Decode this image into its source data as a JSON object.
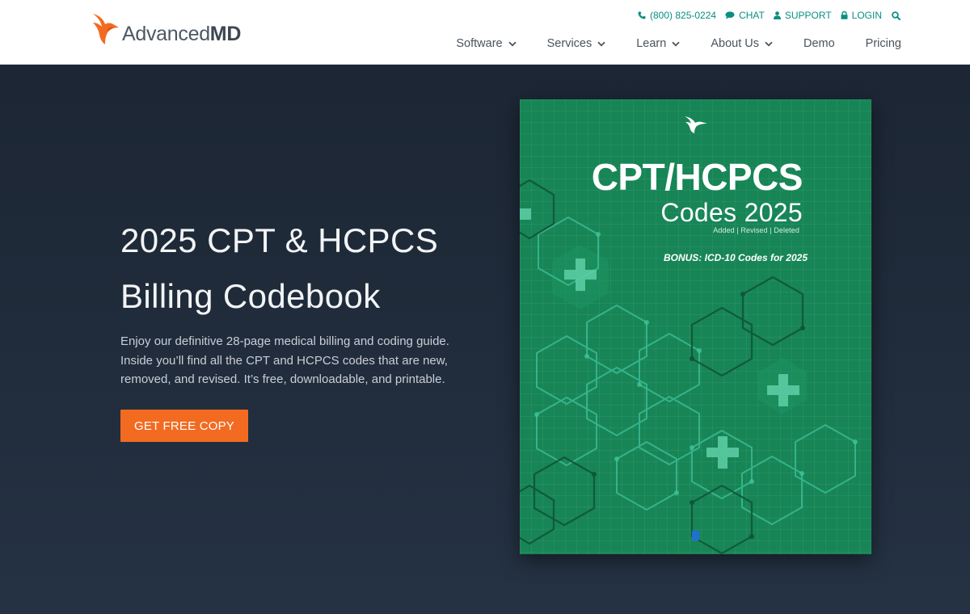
{
  "brand": {
    "logo_regular": "Advanced",
    "logo_bold": "MD"
  },
  "utility_nav": [
    {
      "icon": "phone-icon",
      "label": "(800) 825-0224"
    },
    {
      "icon": "chat-icon",
      "label": "CHAT"
    },
    {
      "icon": "user-icon",
      "label": "SUPPORT"
    },
    {
      "icon": "lock-icon",
      "label": "LOGIN"
    }
  ],
  "main_nav": [
    {
      "label": "Software",
      "dropdown": true
    },
    {
      "label": "Services",
      "dropdown": true
    },
    {
      "label": "Learn",
      "dropdown": true
    },
    {
      "label": "About Us",
      "dropdown": true
    },
    {
      "label": "Demo",
      "dropdown": false
    },
    {
      "label": "Pricing",
      "dropdown": false
    }
  ],
  "hero": {
    "title_line1": "2025 CPT & HCPCS",
    "title_line2": "Billing Codebook",
    "description": "Enjoy our definitive 28-page medical billing and coding guide. Inside you’ll find all the CPT and HCPCS codes that are new, removed, and revised. It’s free, downloadable, and printable.",
    "cta_label": "GET FREE COPY"
  },
  "book": {
    "title": "CPT/HCPCS",
    "subtitle": "Codes 2025",
    "tags": "Added | Revised | Deleted",
    "bonus": "BONUS: ICD-10 Codes for 2025"
  },
  "colors": {
    "accent_orange": "#f26b21",
    "teal_links": "#0a8f82",
    "hero_background": "#222d3b",
    "book_green": "#178556"
  }
}
